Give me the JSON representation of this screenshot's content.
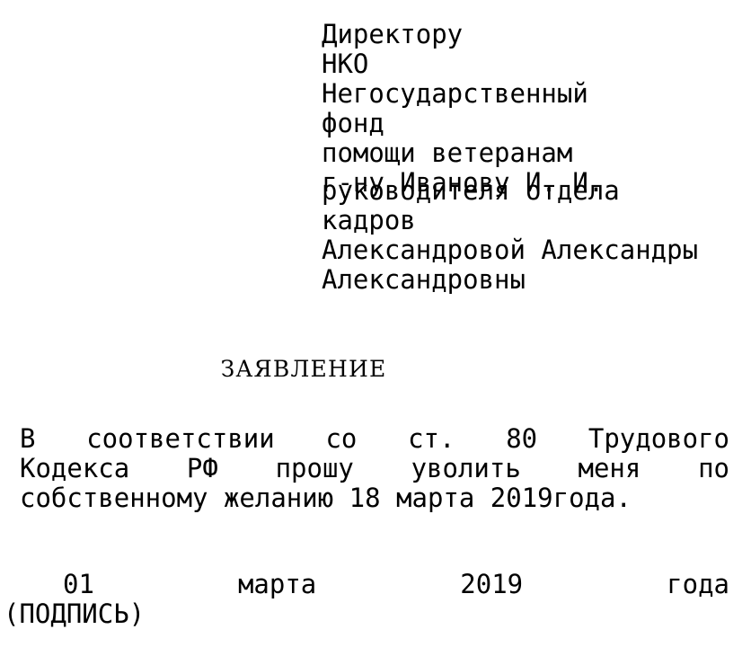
{
  "document": {
    "background_color": "#ffffff",
    "text_color": "#000000",
    "addressee": {
      "line1": "Директору                       НКО",
      "line2": "Негосударственный          фонд",
      "line3": "помощи ветеранам",
      "line4": "г-ну Иванову И. И."
    },
    "applicant": {
      "line1": "руководителя отдела",
      "line2": "кадров",
      "line3": "Александровой Александры",
      "line4": "Александровны"
    },
    "title": "ЗАЯВЛЕНИЕ",
    "body": {
      "line1": "В  соответствии  со  ст.  80  Трудового",
      "line2": "Кодекса  РФ  прошу  уволить  меня  по",
      "line3": "собственному желанию 18 марта 2019года."
    },
    "footer": {
      "date_line": "01        марта        2019        года",
      "signature": "(ПОДПИСЬ)"
    }
  }
}
